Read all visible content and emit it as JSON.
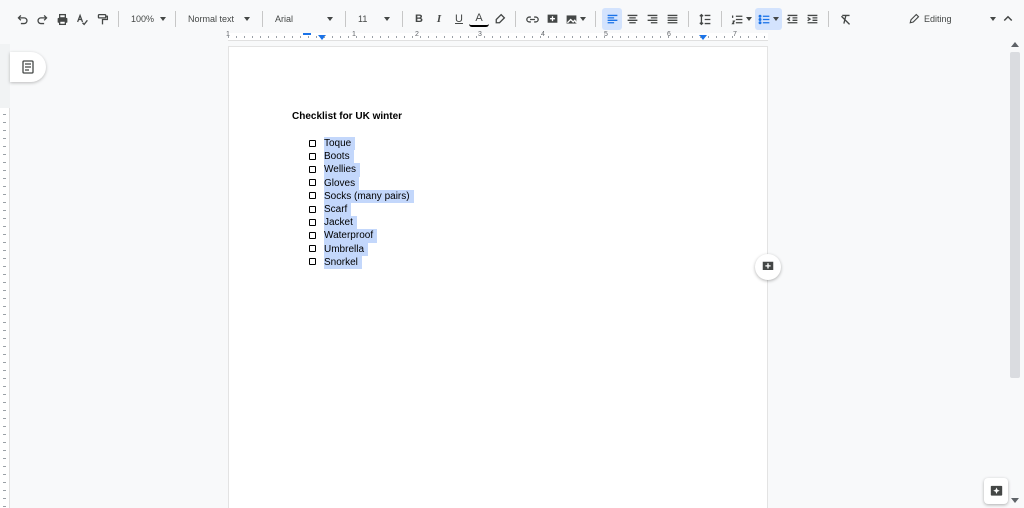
{
  "toolbar": {
    "zoom": "100%",
    "style": "Normal text",
    "font": "Arial",
    "font_size": "11",
    "bold": "B",
    "italic": "I",
    "underline": "U",
    "text_color": "A",
    "mode": "Editing"
  },
  "ruler": {
    "numbers": [
      "1",
      "1",
      "2",
      "3",
      "4",
      "5",
      "6",
      "7"
    ]
  },
  "document": {
    "title": "Checklist for UK winter",
    "items": [
      "Toque",
      "Boots",
      "Wellies",
      "Gloves",
      "Socks (many pairs)",
      "Scarf",
      "Jacket",
      "Waterproof",
      "Umbrella",
      "Snorkel"
    ]
  },
  "colors": {
    "selection": "#c3d7fb",
    "accent": "#1a73e8"
  }
}
